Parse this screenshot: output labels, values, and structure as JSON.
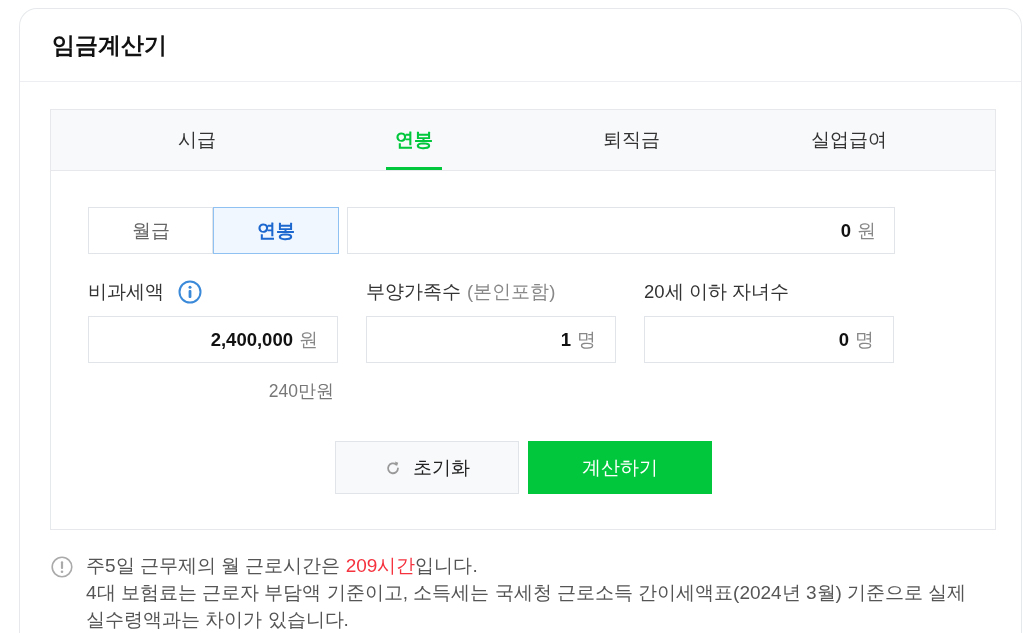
{
  "title": "임금계산기",
  "tabs": [
    {
      "label": "시급",
      "selected": false
    },
    {
      "label": "연봉",
      "selected": true
    },
    {
      "label": "퇴직금",
      "selected": false
    },
    {
      "label": "실업급여",
      "selected": false
    }
  ],
  "pay_type": [
    {
      "label": "월급",
      "selected": false
    },
    {
      "label": "연봉",
      "selected": true
    }
  ],
  "amount_field": {
    "value": "0",
    "unit": "원"
  },
  "fields": [
    {
      "label": "비과세액",
      "info": true,
      "value": "2,400,000",
      "unit": "원",
      "note": "240만원"
    },
    {
      "label": "부양가족수",
      "hint": "(본인포함)",
      "info": false,
      "value": "1",
      "unit": "명"
    },
    {
      "label": "20세 이하 자녀수",
      "info": false,
      "value": "0",
      "unit": "명"
    }
  ],
  "buttons": [
    {
      "kind": "reset",
      "label": "초기화"
    },
    {
      "kind": "primary",
      "label": "계산하기"
    }
  ],
  "notice": {
    "lines": [
      [
        {
          "text": "주5일 근무제의 월 근로시간은 ",
          "highlight": false
        },
        {
          "text": "209시간",
          "highlight": true
        },
        {
          "text": "입니다.",
          "highlight": false
        }
      ],
      [
        {
          "text": "4대 보험료는 근로자 부담액 기준이고, 소득세는 국세청 근로소득 간이세액표(2024년 3월) 기준으로 실제 실수령액과는 차이가 있습니다.",
          "highlight": false
        }
      ]
    ]
  }
}
